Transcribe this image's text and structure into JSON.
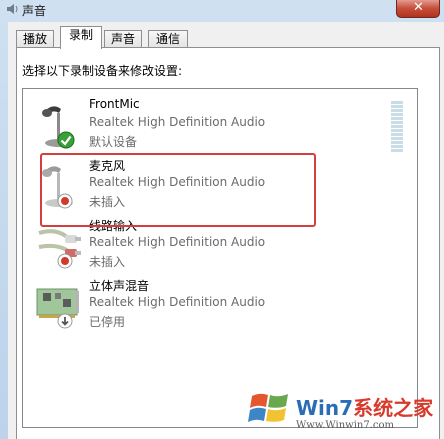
{
  "window": {
    "title": "声音",
    "close_glyph": "✕"
  },
  "tabs": [
    {
      "label": "播放",
      "active": false
    },
    {
      "label": "录制",
      "active": true
    },
    {
      "label": "声音",
      "active": false
    },
    {
      "label": "通信",
      "active": false
    }
  ],
  "instruction": "选择以下录制设备来修改设置:",
  "devices": [
    {
      "name": "FrontMic",
      "driver": "Realtek High Definition Audio",
      "status": "默认设备",
      "icon": "microphone-default-icon",
      "badge": "green-check"
    },
    {
      "name": "麦克风",
      "driver": "Realtek High Definition Audio",
      "status": "未插入",
      "icon": "microphone-icon",
      "badge": "red-down-arrow"
    },
    {
      "name": "线路输入",
      "driver": "Realtek High Definition Audio",
      "status": "未插入",
      "icon": "line-in-cable-icon",
      "badge": "red-down-arrow"
    },
    {
      "name": "立体声混音",
      "driver": "Realtek High Definition Audio",
      "status": "已停用",
      "icon": "sound-card-icon",
      "badge": "gray-down-arrow"
    }
  ],
  "watermark": {
    "brand_a": "Win7",
    "brand_b": "系统之家",
    "url": "Www.Winwin7.com"
  },
  "colors": {
    "highlight": "#d33f3f",
    "watermark_blue": "#2b6db5",
    "watermark_red": "#d83a2c"
  }
}
